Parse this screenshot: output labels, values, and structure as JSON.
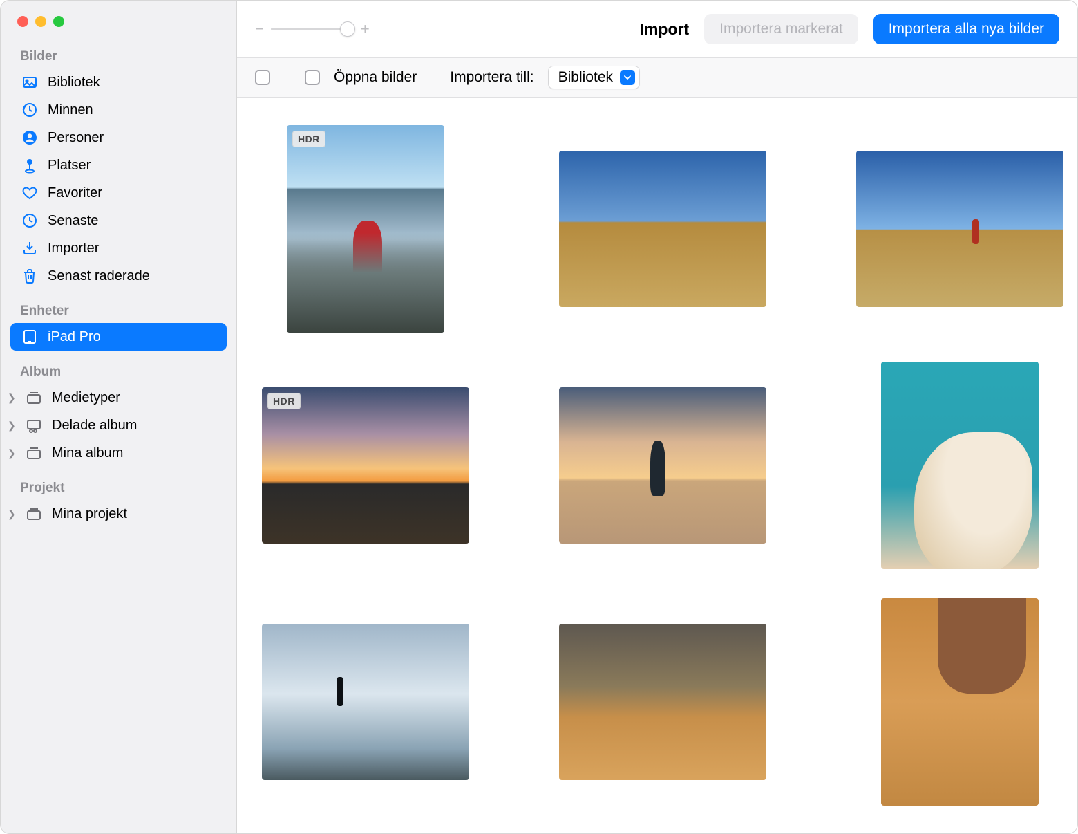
{
  "toolbar": {
    "title": "Import",
    "import_selected_label": "Importera markerat",
    "import_all_label": "Importera alla nya bilder",
    "zoom_minus": "−",
    "zoom_plus": "+"
  },
  "option_bar": {
    "open_photos_label": "Öppna bilder",
    "import_to_label": "Importera till:",
    "import_to_value": "Bibliotek"
  },
  "sidebar": {
    "sections": {
      "photos": "Bilder",
      "devices": "Enheter",
      "albums": "Album",
      "projects": "Projekt"
    },
    "library": "Bibliotek",
    "memories": "Minnen",
    "people": "Personer",
    "places": "Platser",
    "favorites": "Favoriter",
    "recents": "Senaste",
    "imports": "Importer",
    "recently_deleted": "Senast raderade",
    "device_ipad": "iPad Pro",
    "media_types": "Medietyper",
    "shared_albums": "Delade album",
    "my_albums": "Mina album",
    "my_projects": "Mina projekt"
  },
  "photos": [
    {
      "orientation": "portrait",
      "hdr": true
    },
    {
      "orientation": "landscape",
      "hdr": false
    },
    {
      "orientation": "landscape",
      "hdr": false
    },
    {
      "orientation": "landscape",
      "hdr": true
    },
    {
      "orientation": "landscape",
      "hdr": false
    },
    {
      "orientation": "portrait",
      "hdr": false
    },
    {
      "orientation": "landscape",
      "hdr": false
    },
    {
      "orientation": "landscape",
      "hdr": false
    },
    {
      "orientation": "portrait",
      "hdr": false
    }
  ],
  "hdr_badge_text": "HDR"
}
